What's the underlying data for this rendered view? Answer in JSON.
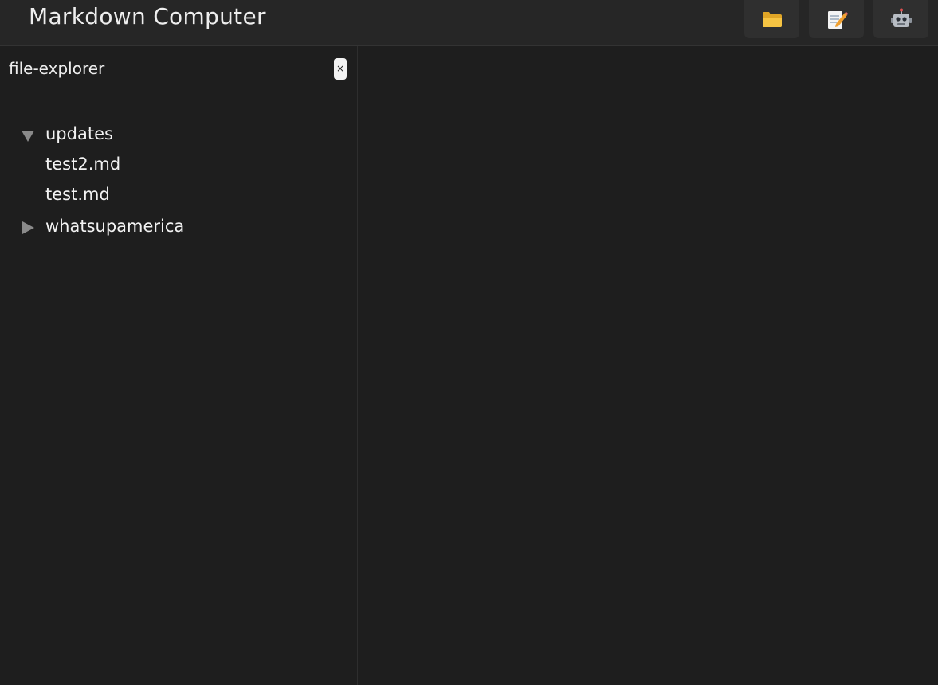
{
  "header": {
    "title": "Markdown Computer",
    "buttons": [
      {
        "name": "file-explorer-button",
        "icon": "folder-icon"
      },
      {
        "name": "editor-button",
        "icon": "memo-icon"
      },
      {
        "name": "assistant-button",
        "icon": "robot-icon"
      }
    ]
  },
  "sidebar": {
    "title": "file-explorer",
    "close_label": "×",
    "tree": [
      {
        "type": "folder",
        "label": "updates",
        "expanded": true
      },
      {
        "type": "file",
        "label": "test2.md"
      },
      {
        "type": "file",
        "label": "test.md"
      },
      {
        "type": "folder",
        "label": "whatsupamerica",
        "expanded": false
      }
    ]
  },
  "colors": {
    "background": "#1e1e1e",
    "header": "#262626",
    "button": "#2f2f2f",
    "text": "#eeeeee",
    "arrow": "#8a8a8a"
  }
}
